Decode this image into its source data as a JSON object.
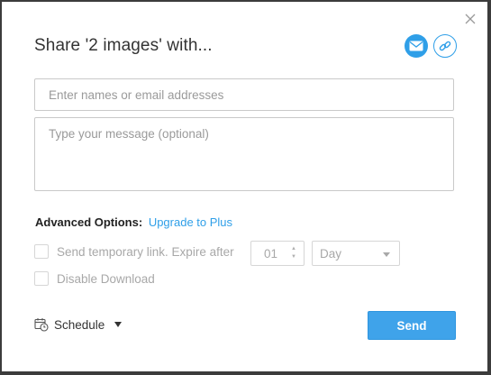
{
  "dialog": {
    "title": "Share '2 images' with...",
    "close_icon": "close-icon",
    "mode_icons": [
      {
        "name": "email-icon",
        "active": true
      },
      {
        "name": "link-icon",
        "active": false
      }
    ]
  },
  "form": {
    "to_placeholder": "Enter names or email addresses",
    "to_value": "",
    "message_placeholder": "Type your message (optional)",
    "message_value": ""
  },
  "advanced": {
    "label": "Advanced Options:",
    "upgrade_link": "Upgrade to Plus",
    "temp_link_label": "Send temporary link. Expire after",
    "temp_link_checked": false,
    "expire_value": "01",
    "expire_unit": "Day",
    "disable_download_label": "Disable Download",
    "disable_download_checked": false
  },
  "footer": {
    "schedule_label": "Schedule",
    "send_label": "Send"
  },
  "colors": {
    "accent": "#2f9fe8",
    "send_button": "#3fa3ea",
    "disabled_text": "#a8a8a8"
  }
}
